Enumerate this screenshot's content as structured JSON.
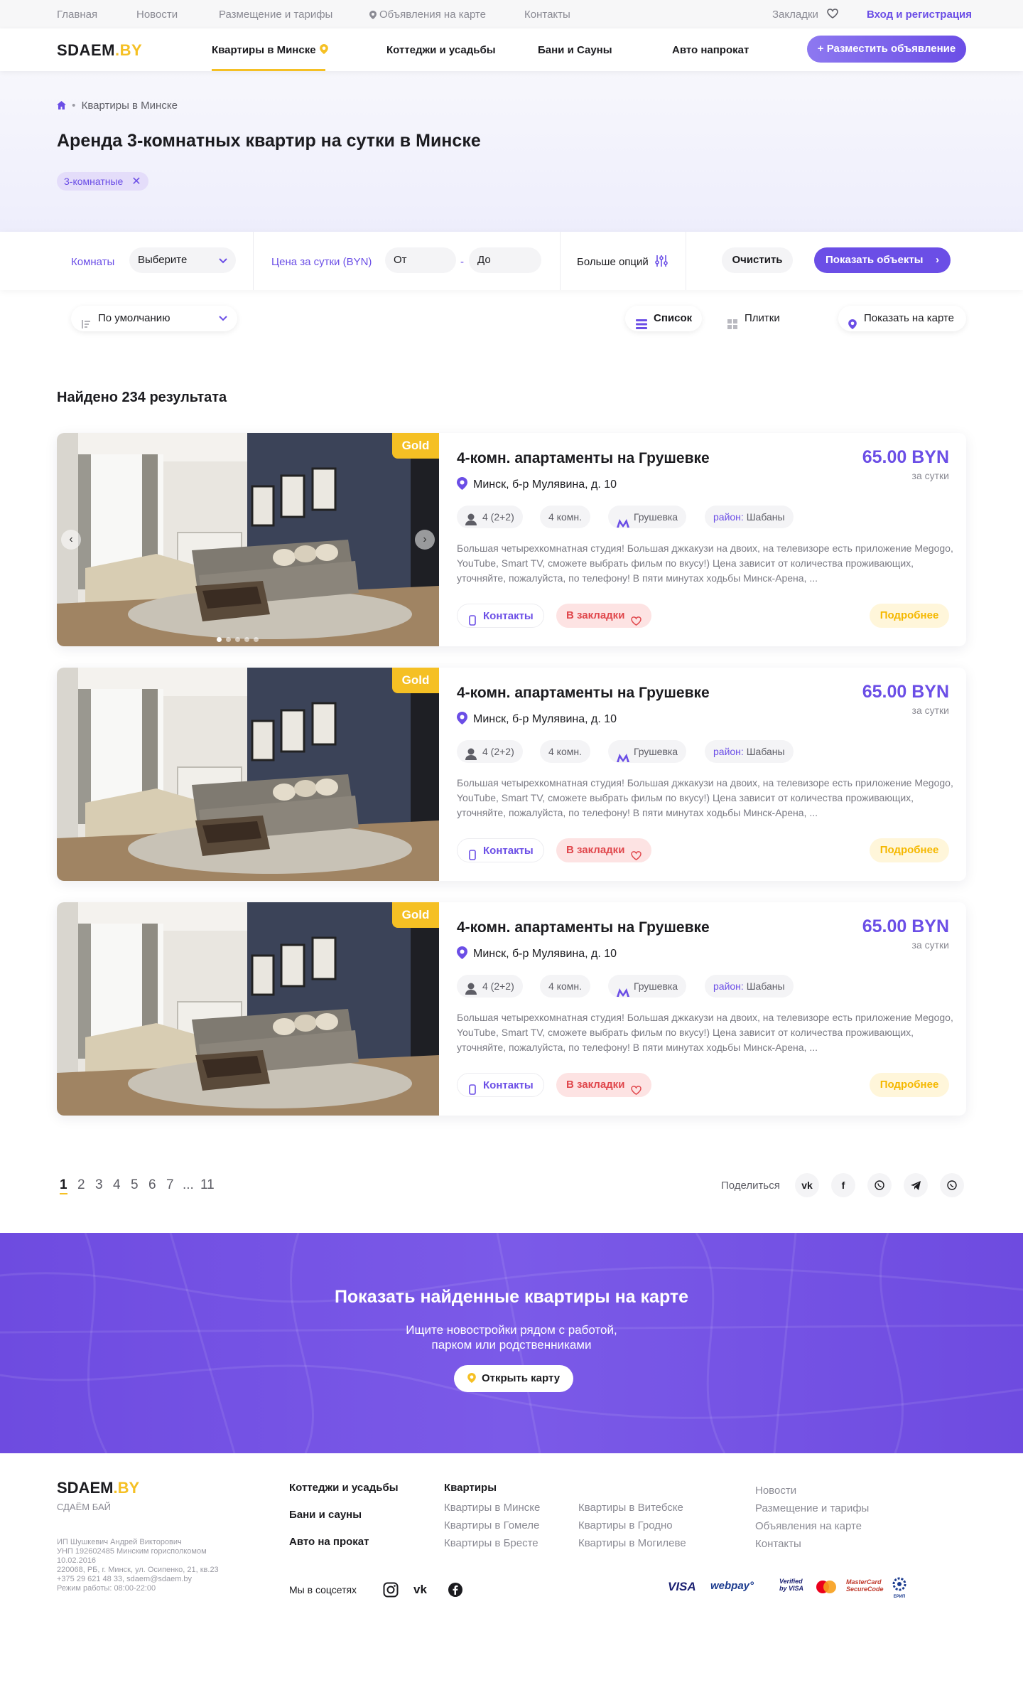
{
  "topbar": {
    "links": [
      "Главная",
      "Новости",
      "Размещение и тарифы",
      "Объявления на карте",
      "Контакты"
    ],
    "bookmarks": "Закладки",
    "login": "Вход и регистрация"
  },
  "header": {
    "logo_main": "SDAEM",
    "logo_suffix": ".BY",
    "nav": [
      "Квартиры в Минске",
      "Коттеджи и усадьбы",
      "Бани и Сауны",
      "Авто напрокат"
    ],
    "post_button": "+ Разместить объявление"
  },
  "hero": {
    "breadcrumb": "Квартиры в Минске",
    "title": "Аренда 3-комнатных квартир на сутки в Минске",
    "chip": "3-комнатные"
  },
  "filter": {
    "rooms_label": "Комнаты",
    "rooms_value": "Выберите",
    "price_label": "Цена за сутки (BYN)",
    "from_placeholder": "От",
    "to_placeholder": "До",
    "dash": "-",
    "more": "Больше опций",
    "clear": "Очистить",
    "show": "Показать объекты"
  },
  "sort": {
    "default": "По умолчанию",
    "list": "Список",
    "tiles": "Плитки",
    "on_map": "Показать на карте"
  },
  "results": {
    "found": "Найдено 234 результата"
  },
  "listings": [
    {
      "badge": "Gold",
      "title": "4-комн. апартаменты на Грушевке",
      "price": "65.00 BYN",
      "per": "за сутки",
      "address": "Минск, б-р Мулявина, д. 10",
      "guests": "4 (2+2)",
      "rooms": "4 комн.",
      "metro": "Грушевка",
      "district_label": "район:",
      "district": "Шабаны",
      "description": "Большая четырехкомнатная студия! Большая джкакузи на двоих, на телевизоре есть приложение Megogo, YouTube, Smart TV, сможете выбрать фильм по вкусу!) Цена зависит от количества проживающих, уточняйте, пожалуйста, по телефону! В пяти минутах ходьбы Минск-Арена, ...",
      "contacts": "Контакты",
      "bookmark": "В закладки",
      "more": "Подробнее"
    },
    {
      "badge": "Gold",
      "title": "4-комн. апартаменты на Грушевке",
      "price": "65.00 BYN",
      "per": "за сутки",
      "address": "Минск, б-р Мулявина, д. 10",
      "guests": "4 (2+2)",
      "rooms": "4 комн.",
      "metro": "Грушевка",
      "district_label": "район:",
      "district": "Шабаны",
      "description": "Большая четырехкомнатная студия! Большая джкакузи на двоих, на телевизоре есть приложение Megogo, YouTube, Smart TV, сможете выбрать фильм по вкусу!) Цена зависит от количества проживающих, уточняйте, пожалуйста, по телефону! В пяти минутах ходьбы Минск-Арена, ...",
      "contacts": "Контакты",
      "bookmark": "В закладки",
      "more": "Подробнее"
    },
    {
      "badge": "Gold",
      "title": "4-комн. апартаменты на Грушевке",
      "price": "65.00 BYN",
      "per": "за сутки",
      "address": "Минск, б-р Мулявина, д. 10",
      "guests": "4 (2+2)",
      "rooms": "4 комн.",
      "metro": "Грушевка",
      "district_label": "район:",
      "district": "Шабаны",
      "description": "Большая четырехкомнатная студия! Большая джкакузи на двоих, на телевизоре есть приложение Megogo, YouTube, Smart TV, сможете выбрать фильм по вкусу!) Цена зависит от количества проживающих, уточняйте, пожалуйста, по телефону! В пяти минутах ходьбы Минск-Арена, ...",
      "contacts": "Контакты",
      "bookmark": "В закладки",
      "more": "Подробнее"
    }
  ],
  "pagination": {
    "pages": [
      "1",
      "2",
      "3",
      "4",
      "5",
      "6",
      "7",
      "...",
      "11"
    ],
    "current": "1",
    "share": "Поделиться",
    "socials": [
      "vk-icon",
      "facebook-icon",
      "viber-icon",
      "telegram-icon",
      "whatsapp-icon"
    ]
  },
  "map_banner": {
    "title": "Показать найденные квартиры на карте",
    "subtitle_line1": "Ищите новостройки рядом с работой,",
    "subtitle_line2": "парком или родственниками",
    "button": "Открыть карту"
  },
  "footer": {
    "logo_main": "SDAEM",
    "logo_suffix": ".BY",
    "tagline": "СДАЁМ БАЙ",
    "legal": [
      "ИП Шушкевич Андрей Викторович",
      "УНП 192602485 Минским горисполкомом",
      "10.02.2016",
      "220068, РБ, г. Минск, ул. Осипенко, 21, кв.23",
      "+375 29 621 48 33, sdaem@sdaem.by",
      "Режим работы: 08:00-22:00"
    ],
    "col1": [
      "Коттеджи и усадьбы",
      "Бани и сауны",
      "Авто на прокат"
    ],
    "apartments_title": "Квартиры",
    "apartments_col1": [
      "Квартиры в Минске",
      "Квартиры в Гомеле",
      "Квартиры в Бресте"
    ],
    "apartments_col2": [
      "Квартиры в Витебске",
      "Квартиры в Гродно",
      "Квартиры в Могилеве"
    ],
    "col4": [
      "Новости",
      "Размещение и тарифы",
      "Объявления на карте",
      "Контакты"
    ],
    "social_label": "Мы в соцсетях",
    "payments": [
      "VISA",
      "webpay°",
      "Verified by VISA",
      "MasterCard",
      "MasterCard SecureCode",
      "ЕРИП"
    ]
  },
  "colors": {
    "accent": "#6b4ee6",
    "gold": "#f5c024",
    "bookmark_bg": "#fde3e3",
    "more_bg": "#fff6da"
  }
}
